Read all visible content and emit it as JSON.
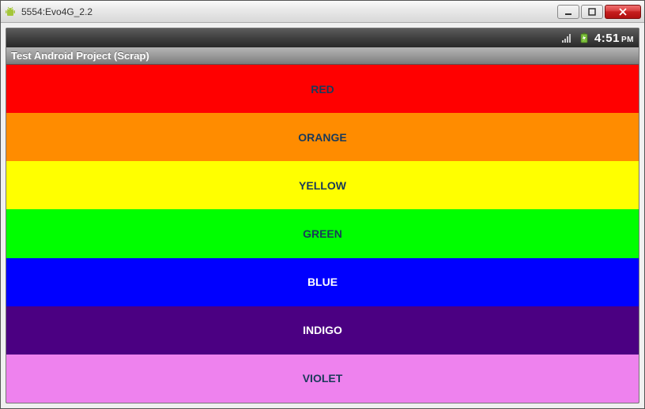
{
  "window": {
    "title": "5554:Evo4G_2.2"
  },
  "statusbar": {
    "time": "4:51",
    "ampm": "PM"
  },
  "app": {
    "header": "Test Android Project (Scrap)"
  },
  "colors": [
    {
      "label": "RED",
      "bg": "#ff0000",
      "fg": "#1a3a5a"
    },
    {
      "label": "ORANGE",
      "bg": "#ff8c00",
      "fg": "#1a3a5a"
    },
    {
      "label": "YELLOW",
      "bg": "#ffff00",
      "fg": "#1a3a5a"
    },
    {
      "label": "GREEN",
      "bg": "#00ff00",
      "fg": "#1a3a5a"
    },
    {
      "label": "BLUE",
      "bg": "#0000ff",
      "fg": "#ffffff"
    },
    {
      "label": "INDIGO",
      "bg": "#4b0082",
      "fg": "#ffffff"
    },
    {
      "label": "VIOLET",
      "bg": "#ee82ee",
      "fg": "#1a3a5a"
    }
  ]
}
